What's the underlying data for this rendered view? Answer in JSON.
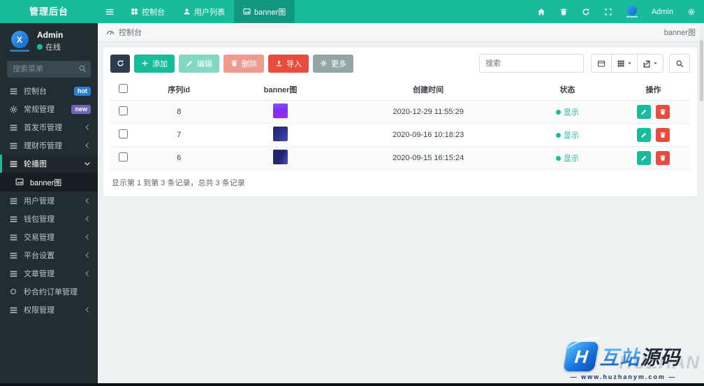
{
  "app": {
    "title": "管理后台"
  },
  "colors": {
    "primary": "#18bc9c",
    "danger": "#e74c3c",
    "dark_button": "#2b3c4e",
    "muted_button": "#95a5a6",
    "sidebar_bg": "#222d32",
    "badge_hot": "#2d7fd1",
    "badge_new": "#7266ba"
  },
  "sidebar": {
    "user": {
      "name": "Admin",
      "status": "在线"
    },
    "search_placeholder": "搜索菜单",
    "items": [
      {
        "label": "控制台",
        "badge": "hot"
      },
      {
        "label": "常规管理",
        "badge": "new"
      },
      {
        "label": "首发币管理"
      },
      {
        "label": "理财币管理"
      },
      {
        "label": "轮播图"
      },
      {
        "label": "banner图"
      },
      {
        "label": "用户管理"
      },
      {
        "label": "钱包管理"
      },
      {
        "label": "交易管理"
      },
      {
        "label": "平台设置"
      },
      {
        "label": "文章管理"
      },
      {
        "label": "秒合约订单管理"
      },
      {
        "label": "权限管理"
      }
    ]
  },
  "navbar": {
    "tabs": [
      {
        "label": "控制台"
      },
      {
        "label": "用户列表"
      },
      {
        "label": "banner图"
      }
    ],
    "user": "Admin"
  },
  "breadcrumb": {
    "home": "控制台",
    "current": "banner图"
  },
  "toolbar": {
    "add": "添加",
    "edit": "编辑",
    "delete": "删除",
    "import": "导入",
    "more": "更多",
    "search_placeholder": "搜索"
  },
  "table": {
    "columns": [
      "序列id",
      "banner图",
      "创建时间",
      "状态",
      "操作"
    ],
    "rows": [
      {
        "id": "8",
        "time": "2020-12-29 11:55:29",
        "status": "显示"
      },
      {
        "id": "7",
        "time": "2020-09-16 10:18:23",
        "status": "显示"
      },
      {
        "id": "6",
        "time": "2020-09-15 16:15:24",
        "status": "显示"
      }
    ],
    "summary": "显示第 1 到第 3 条记录，总共 3 条记录"
  },
  "watermark": {
    "brand_blue": "互站",
    "brand_dark": "源码",
    "ghost": "HUZHAN",
    "url": "— www.huzhanym.com —"
  }
}
